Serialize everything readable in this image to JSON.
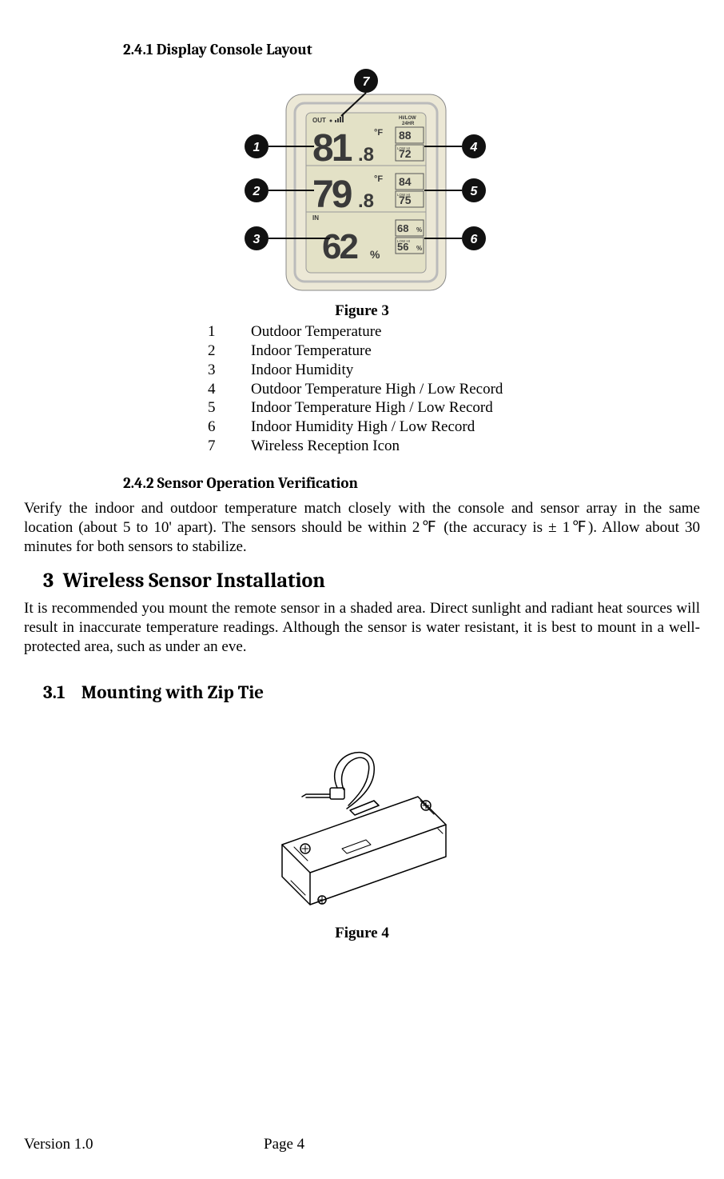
{
  "section_241": {
    "num": "2.4.1",
    "title": "Display Console Layout"
  },
  "figure3": {
    "caption": "Figure 3",
    "legend": [
      {
        "n": "1",
        "label": "Outdoor Temperature"
      },
      {
        "n": "2",
        "label": "Indoor Temperature"
      },
      {
        "n": "3",
        "label": "Indoor Humidity"
      },
      {
        "n": "4",
        "label": "Outdoor Temperature High / Low Record"
      },
      {
        "n": "5",
        "label": "Indoor Temperature High / Low Record"
      },
      {
        "n": "6",
        "label": "Indoor Humidity High / Low Record"
      },
      {
        "n": "7",
        "label": "Wireless Reception Icon"
      }
    ]
  },
  "device": {
    "out_label": "OUT",
    "in_label": "IN",
    "hilow_label": "HI/LOW\n24HR",
    "unit_f": "°F",
    "unit_pct": "%",
    "low_hi": "LOW HI",
    "out_temp": "81.8",
    "in_temp": "79.8",
    "humidity": "62",
    "out_hi": "88",
    "out_lo": "72",
    "in_hi": "84",
    "in_lo": "75",
    "hum_hi": "68",
    "hum_lo": "56",
    "hum_pct_suffix": "%"
  },
  "section_242": {
    "num": "2.4.2",
    "title": "Sensor Operation Verification",
    "body": "Verify the indoor and outdoor temperature match closely with the console and sensor array in the same location (about 5 to 10' apart). The sensors should be within 2℉ (the accuracy is ± 1℉).   Allow about 30 minutes for both sensors to stabilize."
  },
  "section_3": {
    "num": "3",
    "title": "Wireless Sensor Installation",
    "body": "It is recommended you mount the remote sensor in a shaded area. Direct sunlight and radiant heat sources will result in inaccurate temperature readings. Although the sensor is water resistant, it is best to mount in a well-protected area, such as under an eve."
  },
  "section_31": {
    "num": "3.1",
    "title": "Mounting with Zip Tie"
  },
  "figure4": {
    "caption": "Figure 4"
  },
  "footer": {
    "version": "Version 1.0",
    "page": "Page 4"
  }
}
